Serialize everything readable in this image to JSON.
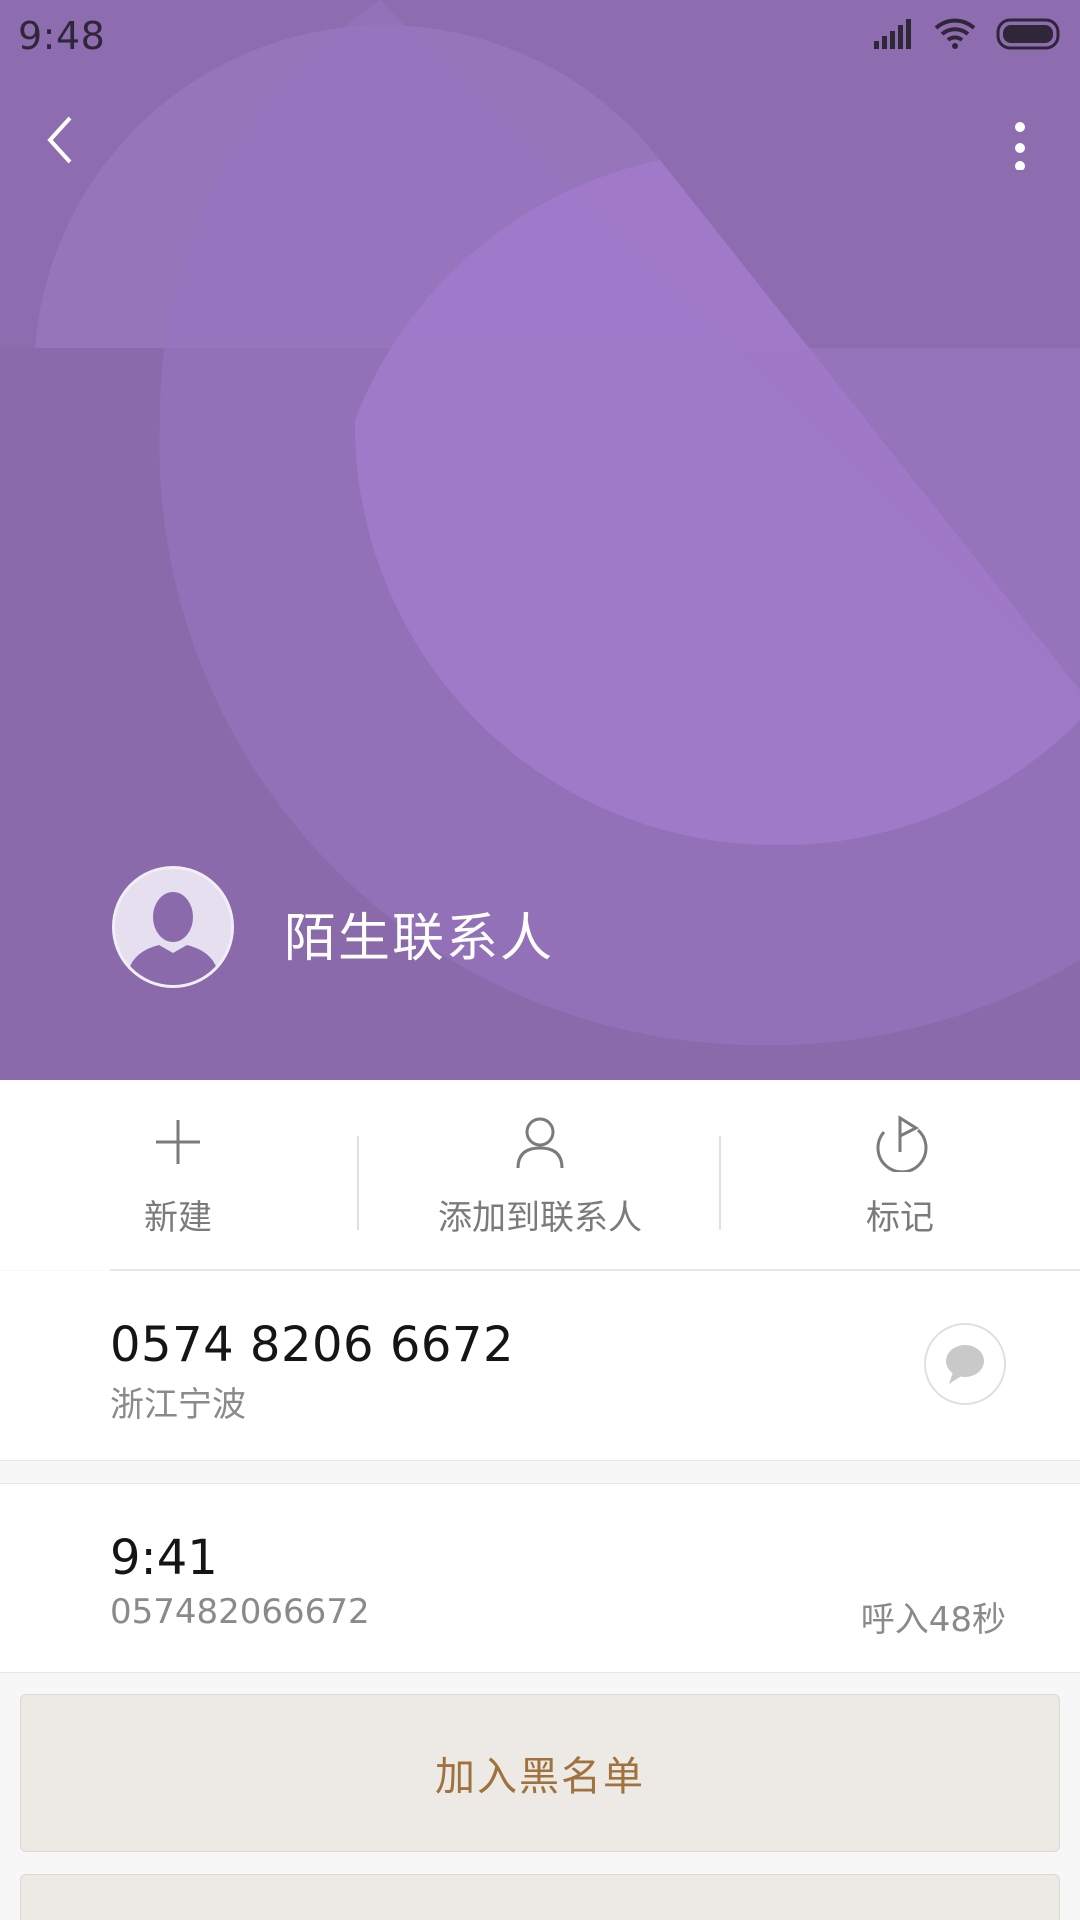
{
  "status_bar": {
    "time": "9:48"
  },
  "header": {
    "contact_name": "陌生联系人",
    "back_icon": "chevron-left-icon",
    "more_icon": "more-vertical-icon"
  },
  "actions": [
    {
      "label": "新建",
      "icon": "plus-icon"
    },
    {
      "label": "添加到联系人",
      "icon": "person-icon"
    },
    {
      "label": "标记",
      "icon": "flag-icon"
    }
  ],
  "number_row": {
    "number": "0574 8206 6672",
    "location": "浙江宁波",
    "message_icon": "message-icon"
  },
  "call_log": {
    "time": "9:41",
    "number": "057482066672",
    "info": "呼入48秒"
  },
  "buttons": {
    "blacklist": "加入黑名单",
    "second": ""
  },
  "colors": {
    "header_bg": "#8a6aab",
    "accent_text": "#a0723e"
  }
}
